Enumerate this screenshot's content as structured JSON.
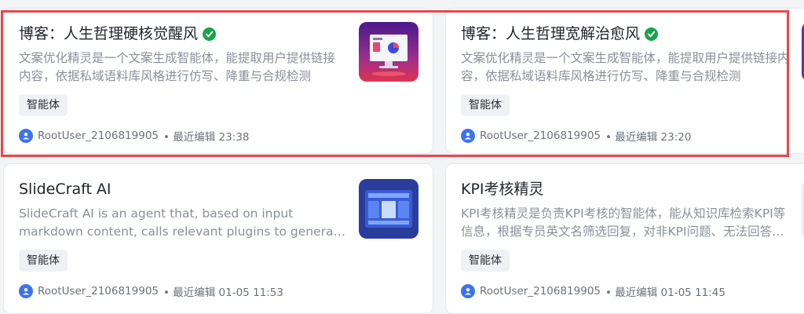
{
  "colors": {
    "highlight": "#e5484d",
    "verified": "#1aa34a",
    "avatar": "#3b73f0"
  },
  "cards": [
    {
      "title": "博客：人生哲理硬核觉醒风",
      "verified": true,
      "description": "文案优化精灵是一个文案生成智能体，能提取用户提供链接内容，依据私域语料库风格进行仿写、降重与合规检测",
      "tag": "智能体",
      "author": "RootUser_2106819905",
      "edited": "• 最近编辑 23:38",
      "thumbnail_icon": "monitor-chart-icon"
    },
    {
      "title": "博客：人生哲理宽解治愈风",
      "verified": true,
      "description": "文案优化精灵是一个文案生成智能体，能提取用户提供链接内容，依据私域语料库风格进行仿写、降重与合规检测",
      "tag": "智能体",
      "author": "RootUser_2106819905",
      "edited": "• 最近编辑 23:20",
      "thumbnail_icon": "purple-thumbnail-icon"
    },
    {
      "title": "SlideCraft AI",
      "verified": false,
      "description": "SlideCraft AI is an agent that, based on input markdown content, calls relevant plugins to generate slides",
      "tag": "智能体",
      "author": "RootUser_2106819905",
      "edited": "• 最近编辑 01-05 11:53",
      "thumbnail_icon": "slides-icon"
    },
    {
      "title": "KPI考核精灵",
      "verified": false,
      "description": "KPI考核精灵是负责KPI考核的智能体，能从知识库检索KPI等信息，根据专员英文名筛选回复，对非KPI问题、无法回答的问题",
      "tag": "智能体",
      "author": "RootUser_2106819905",
      "edited": "• 最近编辑 01-05 11:45",
      "thumbnail_icon": "kpi-thumbnail-icon"
    }
  ]
}
